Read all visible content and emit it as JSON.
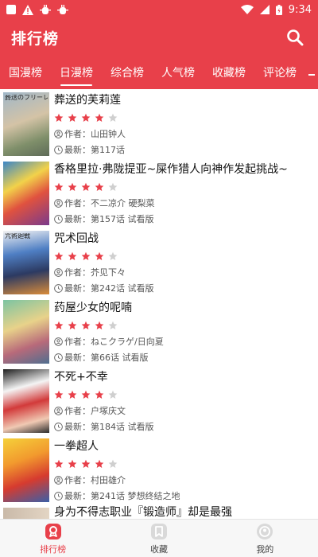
{
  "status_bar": {
    "time": "9:34"
  },
  "app_bar": {
    "title": "排行榜",
    "search_icon": "search-icon"
  },
  "tabs": [
    {
      "label": "国漫榜",
      "active": false
    },
    {
      "label": "日漫榜",
      "active": true
    },
    {
      "label": "综合榜",
      "active": false
    },
    {
      "label": "人气榜",
      "active": false
    },
    {
      "label": "收藏榜",
      "active": false
    },
    {
      "label": "评论榜",
      "active": false
    }
  ],
  "colors": {
    "accent": "#e8404a",
    "star_on": "#e8404a",
    "star_off": "#cfcfcf"
  },
  "rating_max": 5,
  "comics": [
    {
      "title": "葬送的芙莉莲",
      "rating": 4,
      "author_prefix": "作者：",
      "author": "山田钟人",
      "latest_prefix": "最新：",
      "latest": "第117话",
      "cover_text": "葬送のフリーレン"
    },
    {
      "title": "香格里拉·弗陇提亚~屎作猎人向神作发起挑战~",
      "rating": 4,
      "author_prefix": "作者：",
      "author": "不二凉介 硬梨菜",
      "latest_prefix": "最新：",
      "latest": "第157话 试看版",
      "cover_text": ""
    },
    {
      "title": "咒术回战",
      "rating": 4,
      "author_prefix": "作者：",
      "author": "芥见下々",
      "latest_prefix": "最新：",
      "latest": "第242话 试看版",
      "cover_text": "咒術廻戦"
    },
    {
      "title": "药屋少女的呢喃",
      "rating": 4,
      "author_prefix": "作者：",
      "author": "ねこクラゲ/日向夏",
      "latest_prefix": "最新：",
      "latest": "第66话 试看版",
      "cover_text": ""
    },
    {
      "title": "不死+不幸",
      "rating": 4,
      "author_prefix": "作者：",
      "author": "户塚庆文",
      "latest_prefix": "最新：",
      "latest": "第184话 试看版",
      "cover_text": ""
    },
    {
      "title": "一拳超人",
      "rating": 4,
      "author_prefix": "作者：",
      "author": "村田雄介",
      "latest_prefix": "最新：",
      "latest": "第241话 梦想终结之地",
      "cover_text": ""
    }
  ],
  "partial_title": "身为不得志职业『锻造师』却是最强",
  "bottom_nav": [
    {
      "label": "排行榜",
      "active": true,
      "icon": "ranking-icon"
    },
    {
      "label": "收藏",
      "active": false,
      "icon": "bookmark-icon"
    },
    {
      "label": "我的",
      "active": false,
      "icon": "profile-icon"
    }
  ]
}
